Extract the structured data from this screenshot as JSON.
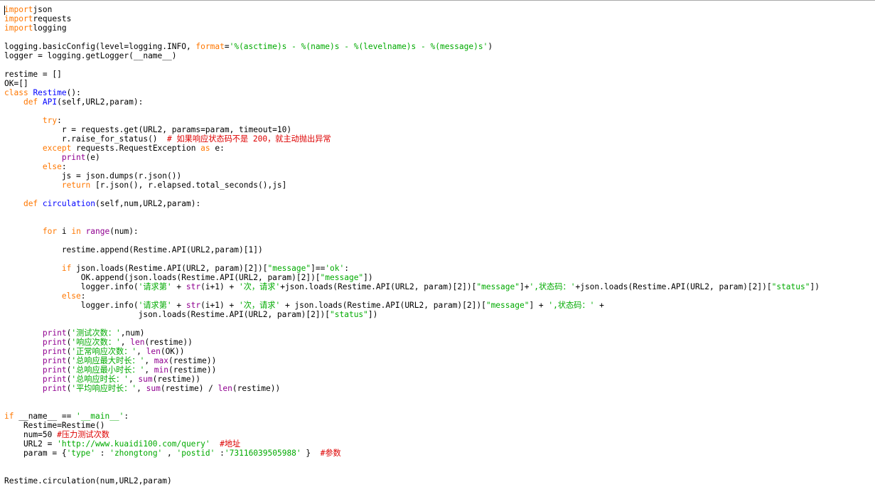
{
  "editor": {
    "colors": {
      "background": "#ffffff",
      "keyword": "#ff7700",
      "builtin": "#900090",
      "definition": "#0000ff",
      "string": "#00aa00",
      "comment": "#dd0000",
      "text": "#000000"
    },
    "lines": [
      [
        [
          "kw",
          "import"
        ],
        [
          "",
          "json"
        ]
      ],
      [
        [
          "kw",
          "import"
        ],
        [
          "",
          "requests"
        ]
      ],
      [
        [
          "kw",
          "import"
        ],
        [
          "",
          "logging"
        ]
      ],
      [],
      [
        [
          "",
          "logging.basicConfig(level=logging.INFO, "
        ],
        [
          "kw",
          "format"
        ],
        [
          "",
          "="
        ],
        [
          "str",
          "'%(asctime)s - %(name)s - %(levelname)s - %(message)s'"
        ],
        [
          "",
          ")"
        ]
      ],
      [
        [
          "",
          "logger = logging.getLogger(__name__)"
        ]
      ],
      [],
      [
        [
          "",
          "restime = []"
        ]
      ],
      [
        [
          "",
          "OK=[]"
        ]
      ],
      [
        [
          "kw",
          "class"
        ],
        [
          "",
          " "
        ],
        [
          "fn",
          "Restime"
        ],
        [
          "",
          "():"
        ]
      ],
      [
        [
          "",
          "    "
        ],
        [
          "kw",
          "def"
        ],
        [
          "",
          " "
        ],
        [
          "fn",
          "API"
        ],
        [
          "",
          "(self,URL2,param):"
        ]
      ],
      [],
      [
        [
          "",
          "        "
        ],
        [
          "kw",
          "try"
        ],
        [
          "",
          ":"
        ]
      ],
      [
        [
          "",
          "            r = requests.get(URL2, params=param, timeout=10)"
        ]
      ],
      [
        [
          "",
          "            r.raise_for_status()  "
        ],
        [
          "cmt",
          "# 如果响应状态码不是 200，就主动抛出异常"
        ]
      ],
      [
        [
          "",
          "        "
        ],
        [
          "kw",
          "except"
        ],
        [
          "",
          " requests.RequestException "
        ],
        [
          "kw",
          "as"
        ],
        [
          "",
          " e:"
        ]
      ],
      [
        [
          "",
          "            "
        ],
        [
          "bi",
          "print"
        ],
        [
          "",
          "(e)"
        ]
      ],
      [
        [
          "",
          "        "
        ],
        [
          "kw",
          "else"
        ],
        [
          "",
          ":"
        ]
      ],
      [
        [
          "",
          "            js = json.dumps(r.json())"
        ]
      ],
      [
        [
          "",
          "            "
        ],
        [
          "kw",
          "return"
        ],
        [
          "",
          " [r.json(), r.elapsed.total_seconds(),js]"
        ]
      ],
      [],
      [
        [
          "",
          "    "
        ],
        [
          "kw",
          "def"
        ],
        [
          "",
          " "
        ],
        [
          "fn",
          "circulation"
        ],
        [
          "",
          "(self,num,URL2,param):"
        ]
      ],
      [],
      [],
      [
        [
          "",
          "        "
        ],
        [
          "kw",
          "for"
        ],
        [
          "",
          " i "
        ],
        [
          "kw",
          "in"
        ],
        [
          "",
          " "
        ],
        [
          "bi",
          "range"
        ],
        [
          "",
          "(num):"
        ]
      ],
      [],
      [
        [
          "",
          "            restime.append(Restime.API(URL2,param)[1])"
        ]
      ],
      [],
      [
        [
          "",
          "            "
        ],
        [
          "kw",
          "if"
        ],
        [
          "",
          " json.loads(Restime.API(URL2, param)[2])["
        ],
        [
          "str",
          "\"message\""
        ],
        [
          "",
          "]=="
        ],
        [
          "str",
          "'ok'"
        ],
        [
          "",
          ":"
        ]
      ],
      [
        [
          "",
          "                OK.append(json.loads(Restime.API(URL2, param)[2])["
        ],
        [
          "str",
          "\"message\""
        ],
        [
          "",
          "])"
        ]
      ],
      [
        [
          "",
          "                logger.info("
        ],
        [
          "str",
          "'请求第'"
        ],
        [
          "",
          " + "
        ],
        [
          "bi",
          "str"
        ],
        [
          "",
          "(i+1) + "
        ],
        [
          "str",
          "'次，请求'"
        ],
        [
          "",
          "+json.loads(Restime.API(URL2, param)[2])["
        ],
        [
          "str",
          "\"message\""
        ],
        [
          "",
          "]+"
        ],
        [
          "str",
          "',状态码：'"
        ],
        [
          "",
          "+json.loads(Restime.API(URL2, param)[2])["
        ],
        [
          "str",
          "\"status\""
        ],
        [
          "",
          "])"
        ]
      ],
      [
        [
          "",
          "            "
        ],
        [
          "kw",
          "else"
        ],
        [
          "",
          ":"
        ]
      ],
      [
        [
          "",
          "                logger.info("
        ],
        [
          "str",
          "'请求第'"
        ],
        [
          "",
          " + "
        ],
        [
          "bi",
          "str"
        ],
        [
          "",
          "(i+1) + "
        ],
        [
          "str",
          "'次，请求'"
        ],
        [
          "",
          " + json.loads(Restime.API(URL2, param)[2])["
        ],
        [
          "str",
          "\"message\""
        ],
        [
          "",
          "] + "
        ],
        [
          "str",
          "',状态码：'"
        ],
        [
          "",
          " +"
        ]
      ],
      [
        [
          "",
          "                            json.loads(Restime.API(URL2, param)[2])["
        ],
        [
          "str",
          "\"status\""
        ],
        [
          "",
          "])"
        ]
      ],
      [],
      [
        [
          "",
          "        "
        ],
        [
          "bi",
          "print"
        ],
        [
          "",
          "("
        ],
        [
          "str",
          "'测试次数：'"
        ],
        [
          "",
          ",num)"
        ]
      ],
      [
        [
          "",
          "        "
        ],
        [
          "bi",
          "print"
        ],
        [
          "",
          "("
        ],
        [
          "str",
          "'响应次数：'"
        ],
        [
          "",
          ", "
        ],
        [
          "bi",
          "len"
        ],
        [
          "",
          "(restime))"
        ]
      ],
      [
        [
          "",
          "        "
        ],
        [
          "bi",
          "print"
        ],
        [
          "",
          "("
        ],
        [
          "str",
          "'正常响应次数：'"
        ],
        [
          "",
          ", "
        ],
        [
          "bi",
          "len"
        ],
        [
          "",
          "(OK))"
        ]
      ],
      [
        [
          "",
          "        "
        ],
        [
          "bi",
          "print"
        ],
        [
          "",
          "("
        ],
        [
          "str",
          "'总响应最大时长：'"
        ],
        [
          "",
          ", "
        ],
        [
          "bi",
          "max"
        ],
        [
          "",
          "(restime))"
        ]
      ],
      [
        [
          "",
          "        "
        ],
        [
          "bi",
          "print"
        ],
        [
          "",
          "("
        ],
        [
          "str",
          "'总响应最小时长：'"
        ],
        [
          "",
          ", "
        ],
        [
          "bi",
          "min"
        ],
        [
          "",
          "(restime))"
        ]
      ],
      [
        [
          "",
          "        "
        ],
        [
          "bi",
          "print"
        ],
        [
          "",
          "("
        ],
        [
          "str",
          "'总响应时长：'"
        ],
        [
          "",
          ", "
        ],
        [
          "bi",
          "sum"
        ],
        [
          "",
          "(restime))"
        ]
      ],
      [
        [
          "",
          "        "
        ],
        [
          "bi",
          "print"
        ],
        [
          "",
          "("
        ],
        [
          "str",
          "'平均响应时长：'"
        ],
        [
          "",
          ", "
        ],
        [
          "bi",
          "sum"
        ],
        [
          "",
          "(restime) / "
        ],
        [
          "bi",
          "len"
        ],
        [
          "",
          "(restime))"
        ]
      ],
      [],
      [],
      [
        [
          "kw",
          "if"
        ],
        [
          "",
          " __name__ == "
        ],
        [
          "str",
          "'__main__'"
        ],
        [
          "",
          ":"
        ]
      ],
      [
        [
          "",
          "    Restime=Restime()"
        ]
      ],
      [
        [
          "",
          "    num=50 "
        ],
        [
          "cmt",
          "#压力测试次数"
        ]
      ],
      [
        [
          "",
          "    URL2 = "
        ],
        [
          "str",
          "'http://www.kuaidi100.com/query'"
        ],
        [
          "",
          "  "
        ],
        [
          "cmt",
          "#地址"
        ]
      ],
      [
        [
          "",
          "    param = {"
        ],
        [
          "str",
          "'type'"
        ],
        [
          "",
          " : "
        ],
        [
          "str",
          "'zhongtong'"
        ],
        [
          "",
          " , "
        ],
        [
          "str",
          "'postid'"
        ],
        [
          "",
          " :"
        ],
        [
          "str",
          "'73116039505988'"
        ],
        [
          "",
          " }  "
        ],
        [
          "cmt",
          "#参数"
        ]
      ],
      [],
      [],
      [
        [
          "",
          "Restime.circulation(num,URL2,param)"
        ]
      ]
    ]
  }
}
